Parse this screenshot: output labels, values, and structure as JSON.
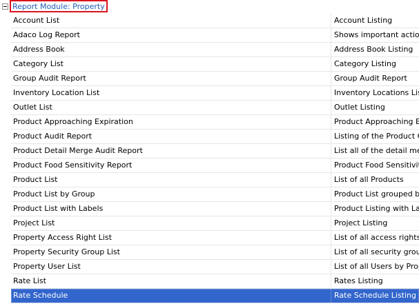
{
  "group": {
    "label": "Report Module: Property",
    "collapsed": false
  },
  "rows": [
    {
      "name": "Account List",
      "description": "Account Listing"
    },
    {
      "name": "Adaco Log Report",
      "description": "Shows important actions t"
    },
    {
      "name": "Address Book",
      "description": "Address Book Listing"
    },
    {
      "name": "Category List",
      "description": "Category Listing"
    },
    {
      "name": "Group Audit Report",
      "description": "Group Audit Report"
    },
    {
      "name": "Inventory Location List",
      "description": "Inventory Locations Listin"
    },
    {
      "name": "Outlet List",
      "description": "Outlet Listing"
    },
    {
      "name": "Product Approaching Expiration",
      "description": "Product Approaching Expir"
    },
    {
      "name": "Product Audit Report",
      "description": "Listing of the Product Cha"
    },
    {
      "name": "Product Detail Merge Audit Report",
      "description": "List all of the detail merge"
    },
    {
      "name": "Product Food Sensitivity Report",
      "description": "Product Food Sensitivity R"
    },
    {
      "name": "Product List",
      "description": "List of all Products"
    },
    {
      "name": "Product List by Group",
      "description": "Product List grouped by a"
    },
    {
      "name": "Product List with Labels",
      "description": "Product Listing with Labels"
    },
    {
      "name": "Project List",
      "description": "Project Listing"
    },
    {
      "name": "Property Access Right List",
      "description": "List of all access rights for"
    },
    {
      "name": "Property Security Group List",
      "description": "List of all security groups i"
    },
    {
      "name": "Property User List",
      "description": "List of all Users by Proper"
    },
    {
      "name": "Rate List",
      "description": "Rates Listing"
    },
    {
      "name": "Rate Schedule",
      "description": "Rate Schedule Listing",
      "selected": true
    }
  ],
  "colors": {
    "group_label_text": "#1f5fb4",
    "group_label_border": "#d9141c",
    "selected_row_background": "#3366cc",
    "selected_row_text": "#ffffff",
    "grid_line": "#e6e6e6"
  },
  "icons": {
    "expander": "minus-box-icon"
  }
}
